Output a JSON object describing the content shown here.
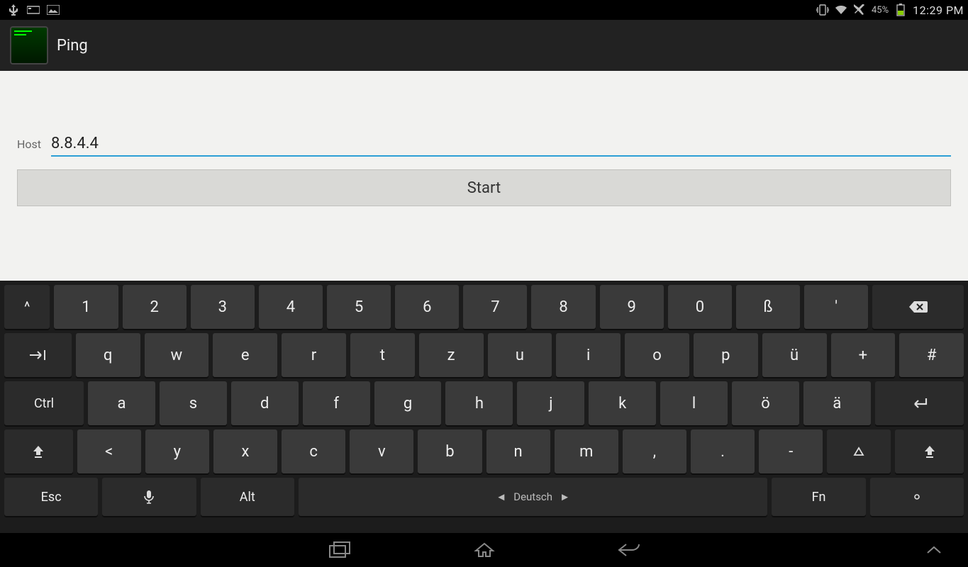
{
  "status": {
    "battery_pct": "45%",
    "clock": "12:29 PM"
  },
  "app": {
    "title": "Ping"
  },
  "form": {
    "host_label": "Host",
    "host_value": "8.8.4.4",
    "start_label": "Start"
  },
  "keyboard": {
    "language": "Deutsch",
    "rows": [
      [
        "^",
        "1",
        "2",
        "3",
        "4",
        "5",
        "6",
        "7",
        "8",
        "9",
        "0",
        "ß",
        "'",
        "⌫"
      ],
      [
        "⇥",
        "q",
        "w",
        "e",
        "r",
        "t",
        "z",
        "u",
        "i",
        "o",
        "p",
        "ü",
        "+",
        "#"
      ],
      [
        "Ctrl",
        "a",
        "s",
        "d",
        "f",
        "g",
        "h",
        "j",
        "k",
        "l",
        "ö",
        "ä",
        "↵"
      ],
      [
        "⇧",
        "<",
        "y",
        "x",
        "c",
        "v",
        "b",
        "n",
        "m",
        ",",
        ".",
        "-",
        "△",
        "⇧"
      ],
      [
        "Esc",
        "🎤",
        "Alt",
        "SPACE",
        "Fn",
        "◦"
      ]
    ]
  }
}
